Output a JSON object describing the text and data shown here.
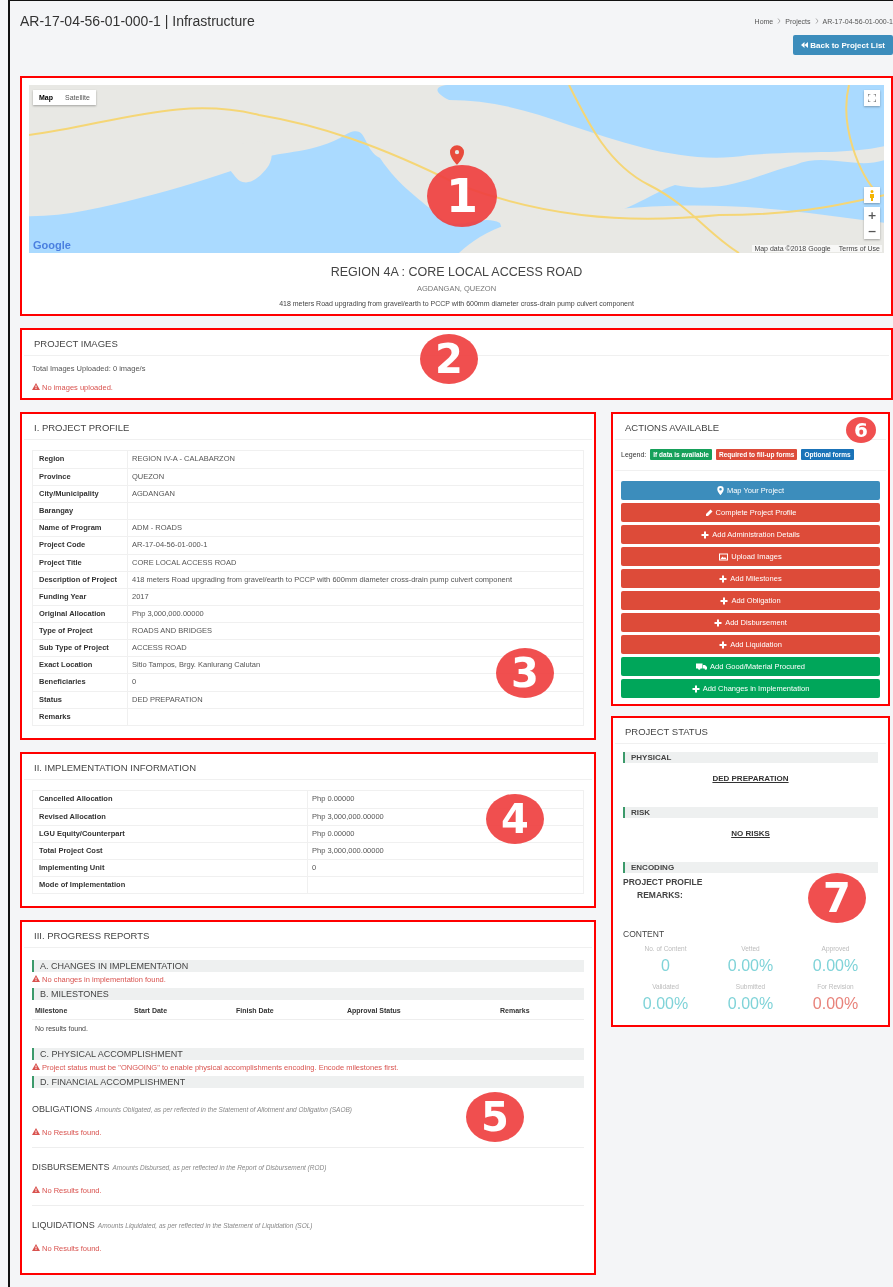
{
  "page": {
    "title": "AR-17-04-56-01-000-1 | Infrastructure",
    "breadcrumb": [
      "Home",
      "Projects",
      "AR-17-04-56-01-000-1"
    ],
    "back_button": "Back to Project List"
  },
  "map_card": {
    "callout": "1",
    "map_types": [
      {
        "label": "Map",
        "selected": true
      },
      {
        "label": "Satellite",
        "selected": false
      }
    ],
    "logo": "Google",
    "attribution": "Map data ©2018 Google",
    "terms": "Terms of Use",
    "zoom_in": "+",
    "zoom_out": "−",
    "title": "REGION 4A : CORE LOCAL ACCESS ROAD",
    "location": "AGDANGAN, QUEZON",
    "description": "418 meters Road upgrading from gravel/earth to PCCP with 600mm diameter cross-drain pump culvert component"
  },
  "project_images": {
    "callout": "2",
    "heading": "PROJECT IMAGES",
    "total": "Total Images Uploaded: 0 image/s",
    "warning": "No images uploaded."
  },
  "project_profile": {
    "callout": "3",
    "heading": "I. PROJECT PROFILE",
    "rows": [
      {
        "label": "Region",
        "value": "REGION IV-A - CALABARZON"
      },
      {
        "label": "Province",
        "value": "QUEZON"
      },
      {
        "label": "City/Municipality",
        "value": "AGDANGAN"
      },
      {
        "label": "Barangay",
        "value": ""
      },
      {
        "label": "Name of Program",
        "value": "ADM - ROADS"
      },
      {
        "label": "Project Code",
        "value": "AR-17-04-56-01-000-1"
      },
      {
        "label": "Project Title",
        "value": "CORE LOCAL ACCESS ROAD"
      },
      {
        "label": "Description of Project",
        "value": "418 meters Road upgrading from gravel/earth to PCCP with 600mm diameter cross-drain pump culvert component"
      },
      {
        "label": "Funding Year",
        "value": "2017"
      },
      {
        "label": "Original Allocation",
        "value": "Php 3,000,000.00000"
      },
      {
        "label": "Type of Project",
        "value": "ROADS AND BRIDGES"
      },
      {
        "label": "Sub Type of Project",
        "value": "ACCESS ROAD"
      },
      {
        "label": "Exact Location",
        "value": "Sitio Tampos, Brgy. Kanlurang Calutan"
      },
      {
        "label": "Beneficiaries",
        "value": "0"
      },
      {
        "label": "Status",
        "value": "DED PREPARATION"
      },
      {
        "label": "Remarks",
        "value": ""
      }
    ]
  },
  "implementation": {
    "callout": "4",
    "heading": "II. IMPLEMENTATION INFORMATION",
    "rows": [
      {
        "label": "Cancelled Allocation",
        "value": "Php 0.00000"
      },
      {
        "label": "Revised Allocation",
        "value": "Php 3,000,000.00000"
      },
      {
        "label": "LGU Equity/Counterpart",
        "value": "Php 0.00000"
      },
      {
        "label": "Total Project Cost",
        "value": "Php 3,000,000.00000"
      },
      {
        "label": "Implementing Unit",
        "value": "0"
      },
      {
        "label": "Mode of Implementation",
        "value": ""
      }
    ]
  },
  "progress_reports": {
    "callout": "5",
    "heading": "III. PROGRESS REPORTS",
    "sections": [
      {
        "kind": "message",
        "title": "A. CHANGES IN IMPLEMENTATION",
        "message": "No changes in implementation found."
      },
      {
        "kind": "table",
        "title": "B. MILESTONES",
        "columns": [
          "Milestone",
          "Start Date",
          "Finish Date",
          "Approval Status",
          "Remarks"
        ],
        "empty": "No results found."
      },
      {
        "kind": "message",
        "title": "C. PHYSICAL ACCOMPLISHMENT",
        "message": "Project status must be \"ONGOING\" to enable physical accomplishments encoding. Encode milestones first."
      },
      {
        "kind": "financial",
        "title": "D. FINANCIAL ACCOMPLISHMENT",
        "groups": [
          {
            "name": "OBLIGATIONS",
            "note": "Amounts Obligated, as per reflected in the Statement of Allotment and Obligation (SAOB)",
            "message": "No Results found."
          },
          {
            "name": "DISBURSEMENTS",
            "note": "Amounts Disbursed, as per reflected in the Report of Disbursement (ROD)",
            "message": "No Results found."
          },
          {
            "name": "LIQUIDATIONS",
            "note": "Amounts Liquidated, as per reflected in the Statement of Liquidation (SOL)",
            "message": "No Results found."
          }
        ]
      }
    ]
  },
  "actions": {
    "callout": "6",
    "heading": "ACTIONS AVAILABLE",
    "legend_label": "Legend:",
    "legend": [
      {
        "label": "If data is available",
        "color": "#16a05a"
      },
      {
        "label": "Required to fill-up forms",
        "color": "#dd4b39"
      },
      {
        "label": "Optional forms",
        "color": "#1a73b8"
      }
    ],
    "buttons": [
      {
        "kind": "marker",
        "label": "Map Your Project",
        "color": "#3c8dbc"
      },
      {
        "kind": "pencil",
        "label": "Complete Project Profile",
        "color": "#dd4b39"
      },
      {
        "kind": "plus",
        "label": "Add Administration Details",
        "color": "#dd4b39"
      },
      {
        "kind": "image",
        "label": "Upload Images",
        "color": "#dd4b39"
      },
      {
        "kind": "plus",
        "label": "Add Milestones",
        "color": "#dd4b39"
      },
      {
        "kind": "plus",
        "label": "Add Obligation",
        "color": "#dd4b39"
      },
      {
        "kind": "plus",
        "label": "Add Disbursement",
        "color": "#dd4b39"
      },
      {
        "kind": "plus",
        "label": "Add Liquidation",
        "color": "#dd4b39"
      },
      {
        "kind": "truck",
        "label": "Add Good/Material Procured",
        "color": "#00a65a"
      },
      {
        "kind": "plus",
        "label": "Add Changes in Implementation",
        "color": "#00a65a"
      }
    ]
  },
  "project_status": {
    "callout": "7",
    "heading": "PROJECT STATUS",
    "physical": {
      "title": "PHYSICAL",
      "value": "DED PREPARATION"
    },
    "risk": {
      "title": "RISK",
      "value": "NO RISKS"
    },
    "encoding": {
      "title": "ENCODING",
      "item": "PROJECT PROFILE",
      "remarks": "REMARKS:"
    },
    "content": {
      "title": "CONTENT",
      "stats": [
        {
          "label": "No. of Content",
          "value": "0",
          "color": "#7fd3d8"
        },
        {
          "label": "Vetted",
          "value": "0.00%",
          "color": "#7fd3d8"
        },
        {
          "label": "Approved",
          "value": "0.00%",
          "color": "#7fd3d8"
        },
        {
          "label": "Validated",
          "value": "0.00%",
          "color": "#7fd3d8"
        },
        {
          "label": "Submitted",
          "value": "0.00%",
          "color": "#7fd3d8"
        },
        {
          "label": "For Revision",
          "value": "0.00%",
          "color": "#e8827a"
        }
      ]
    }
  }
}
